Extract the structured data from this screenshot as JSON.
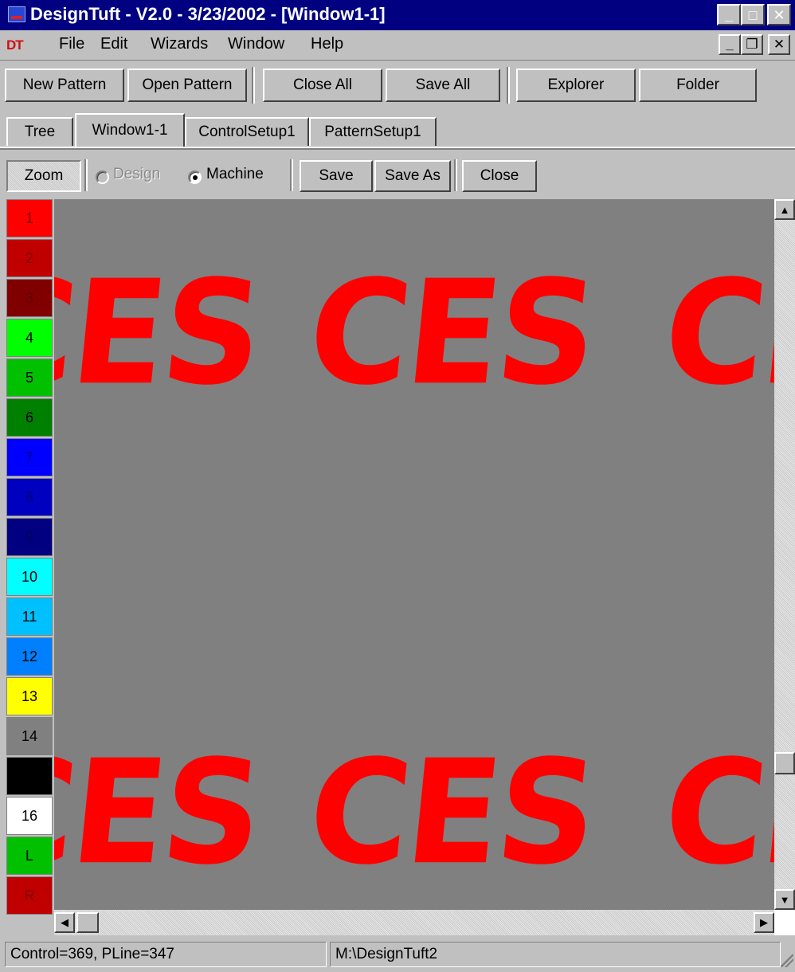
{
  "window": {
    "title": "DesignTuft - V2.0 - 3/23/2002 - [Window1-1]",
    "minimize": "_",
    "maximize": "□",
    "close": "✕"
  },
  "menu": {
    "logo": "DT",
    "items": [
      "File",
      "Edit",
      "Wizards",
      "Window",
      "Help"
    ],
    "mdi_minimize": "_",
    "mdi_restore": "❐",
    "mdi_close": "✕"
  },
  "toolbar": {
    "new_pattern": "New Pattern",
    "open_pattern": "Open Pattern",
    "close_all": "Close All",
    "save_all": "Save All",
    "explorer": "Explorer",
    "folder": "Folder"
  },
  "tabs": [
    "Tree",
    "Window1-1",
    "ControlSetup1",
    "PatternSetup1"
  ],
  "active_tab": "Window1-1",
  "pattern_toolbar": {
    "zoom": "Zoom",
    "design": "Design",
    "machine": "Machine",
    "selected_mode": "Machine",
    "save": "Save",
    "save_as": "Save As",
    "close": "Close"
  },
  "palette": [
    {
      "label": "1",
      "color": "#ff0000",
      "text": "#800000"
    },
    {
      "label": "2",
      "color": "#c00000",
      "text": "#800000"
    },
    {
      "label": "3",
      "color": "#800000",
      "text": "#600000"
    },
    {
      "label": "4",
      "color": "#00ff00",
      "text": "#000000"
    },
    {
      "label": "5",
      "color": "#00c000",
      "text": "#000000"
    },
    {
      "label": "6",
      "color": "#008000",
      "text": "#000000"
    },
    {
      "label": "7",
      "color": "#0000ff",
      "text": "#000080"
    },
    {
      "label": "8",
      "color": "#0000c0",
      "text": "#000080"
    },
    {
      "label": "9",
      "color": "#000080",
      "text": "#000060"
    },
    {
      "label": "10",
      "color": "#00ffff",
      "text": "#000000"
    },
    {
      "label": "11",
      "color": "#00c0ff",
      "text": "#000000"
    },
    {
      "label": "12",
      "color": "#0080ff",
      "text": "#000000"
    },
    {
      "label": "13",
      "color": "#ffff00",
      "text": "#000000"
    },
    {
      "label": "14",
      "color": "#808080",
      "text": "#000000"
    },
    {
      "label": "",
      "color": "#000000",
      "text": "#000000"
    },
    {
      "label": "16",
      "color": "#ffffff",
      "text": "#000000"
    },
    {
      "label": "L",
      "color": "#00c000",
      "text": "#000000"
    },
    {
      "label": "R",
      "color": "#c00000",
      "text": "#800000"
    }
  ],
  "canvas": {
    "text": "CES",
    "background": "#808080",
    "text_color": "#ff0000"
  },
  "status": {
    "left": "Control=369, PLine=347",
    "right": "M:\\DesignTuft2"
  }
}
